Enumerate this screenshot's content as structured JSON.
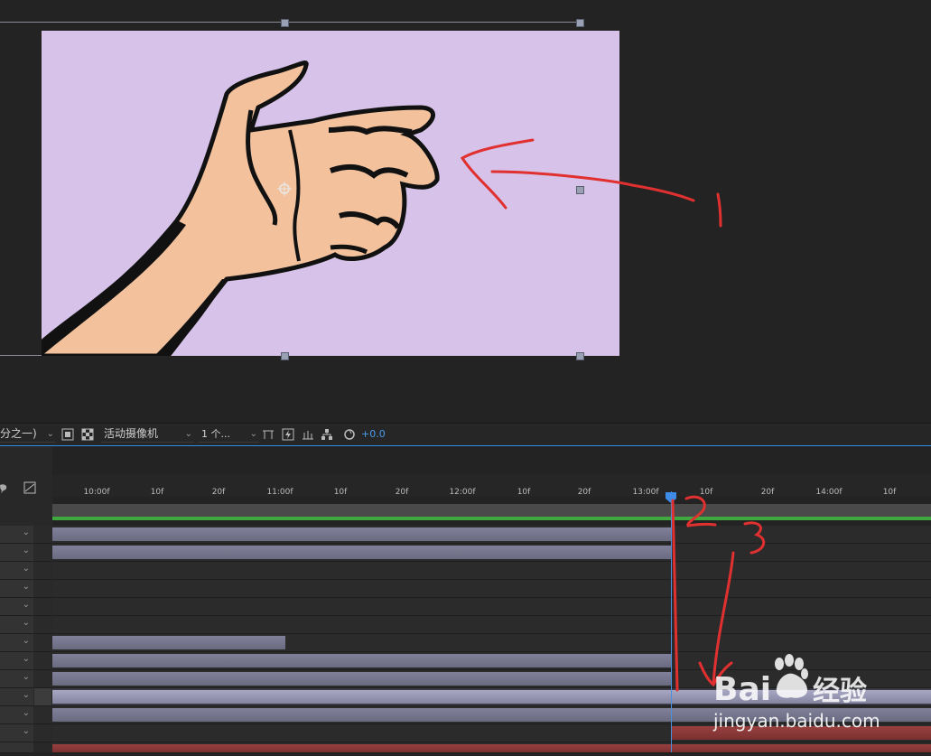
{
  "toolbar": {
    "resolution_label": "分之一)",
    "camera_label": "活动摄像机",
    "views_label": "1 个...",
    "exposure_value": "+0.0"
  },
  "timeline": {
    "ruler_labels": [
      "10:00f",
      "10f",
      "20f",
      "11:00f",
      "10f",
      "20f",
      "12:00f",
      "10f",
      "20f",
      "13:00f",
      "10f",
      "20f",
      "14:00f",
      "10f"
    ]
  },
  "annotations": {
    "numbers": [
      "1",
      "2",
      "3"
    ]
  },
  "watermark": {
    "brand": "Baidu经验",
    "url": "jingyan.baidu.com"
  },
  "colors": {
    "comp_background": "#d7c3ea",
    "skin": "#f3c29d",
    "annotation_red": "#e03030",
    "playhead_blue": "#4a8fe0",
    "green_bar": "#3fa93f",
    "layer_bar": "#7a7a90",
    "red_bar": "#8a3a3a"
  }
}
